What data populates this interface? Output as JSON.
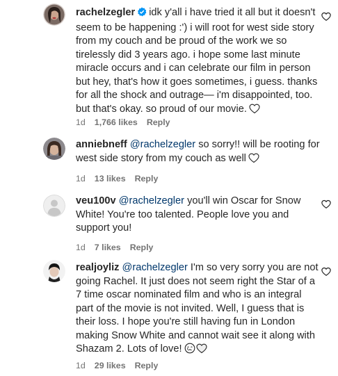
{
  "comments": [
    {
      "username": "rachelzegler",
      "verified": true,
      "lines": [
        "idk y'all i have tried it all but it doesn't",
        "seem to be happening :') i will root for west side story",
        "from my couch and be proud of the work we so",
        "tirelessly did 3 years ago. i hope some last minute",
        "miracle occurs and i can celebrate our film in person",
        "but hey, that's how it goes sometimes, i guess. thanks",
        "for all the shock and outrage— i'm disappointed, too.",
        "but that's okay. so proud of our movie."
      ],
      "time": "1d",
      "likes": "1,766 likes",
      "reply": "Reply"
    },
    {
      "username": "anniebneff",
      "mention": "@rachelzegler",
      "lines": [
        "so sorry!! will be rooting for",
        "west side story from my couch as well"
      ],
      "time": "1d",
      "likes": "13 likes",
      "reply": "Reply"
    },
    {
      "username": "veu100v",
      "mention": "@rachelzegler",
      "lines": [
        "you'll win Oscar for Snow",
        "White! You're too talented. People love you and",
        "support you!"
      ],
      "time": "1d",
      "likes": "7 likes",
      "reply": "Reply"
    },
    {
      "username": "realjoyliz",
      "mention": "@rachelzegler",
      "lines": [
        "I'm so very sorry you are not",
        "going Rachel. It just does not seem right the Star of a",
        "7 time oscar nominated film and who is an integral",
        "part of the movie is not invited. Well, I guess that is",
        "their loss. I hope you're still having fun in London",
        "making Snow White and cannot wait see it along with",
        "Shazam 2. Lots of love!"
      ],
      "time": "1d",
      "likes": "29 likes",
      "reply": "Reply"
    }
  ],
  "icons": {
    "like": "heart-outline-icon",
    "verified": "verified-badge-icon",
    "verified_color": "#0095f6",
    "mention_color": "#00376b",
    "meta_color": "#737373"
  }
}
